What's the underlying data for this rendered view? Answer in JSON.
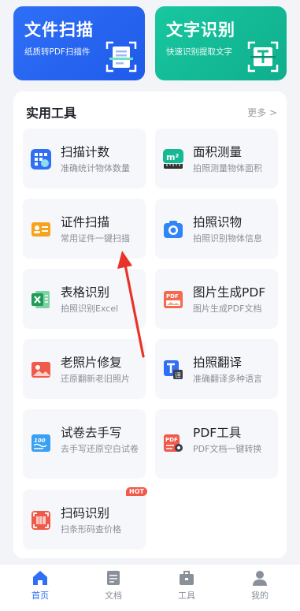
{
  "top_cards": {
    "scan": {
      "title": "文件扫描",
      "subtitle": "纸质转PDF扫描件"
    },
    "ocr": {
      "title": "文字识别",
      "subtitle": "快速识别提取文字"
    }
  },
  "tools_section": {
    "title": "实用工具",
    "more_label": "更多 >",
    "items": [
      {
        "name": "扫描计数",
        "desc": "准确统计物体数量",
        "icon": "count-grid-icon"
      },
      {
        "name": "面积测量",
        "desc": "拍照测量物体面积",
        "icon": "area-ruler-icon"
      },
      {
        "name": "证件扫描",
        "desc": "常用证件一键扫描",
        "icon": "id-card-icon"
      },
      {
        "name": "拍照识物",
        "desc": "拍照识别物体信息",
        "icon": "camera-icon"
      },
      {
        "name": "表格识别",
        "desc": "拍照识别Excel",
        "icon": "excel-icon"
      },
      {
        "name": "图片生成PDF",
        "desc": "图片生成PDF文档",
        "icon": "image-pdf-icon"
      },
      {
        "name": "老照片修复",
        "desc": "还原翻新老旧照片",
        "icon": "photo-restore-icon"
      },
      {
        "name": "拍照翻译",
        "desc": "准确翻译多种语言",
        "icon": "translate-icon"
      },
      {
        "name": "试卷去手写",
        "desc": "去手写还原空白试卷",
        "icon": "exam-icon"
      },
      {
        "name": "PDF工具",
        "desc": "PDF文档一键转换",
        "icon": "pdf-tool-icon"
      },
      {
        "name": "扫码识别",
        "desc": "扫条形码查价格",
        "icon": "barcode-icon",
        "badge": "HOT"
      }
    ]
  },
  "bottom_nav": {
    "items": [
      {
        "label": "首页",
        "icon": "home-icon",
        "active": true
      },
      {
        "label": "文档",
        "icon": "document-icon",
        "active": false
      },
      {
        "label": "工具",
        "icon": "toolbox-icon",
        "active": false
      },
      {
        "label": "我的",
        "icon": "profile-icon",
        "active": false
      }
    ]
  },
  "colors": {
    "primary": "#2f6ff6",
    "scan_card": "#2f6ff6",
    "ocr_card": "#18c7a0",
    "annotation_arrow": "#e8332a",
    "hot_badge": "#f25a4a"
  }
}
